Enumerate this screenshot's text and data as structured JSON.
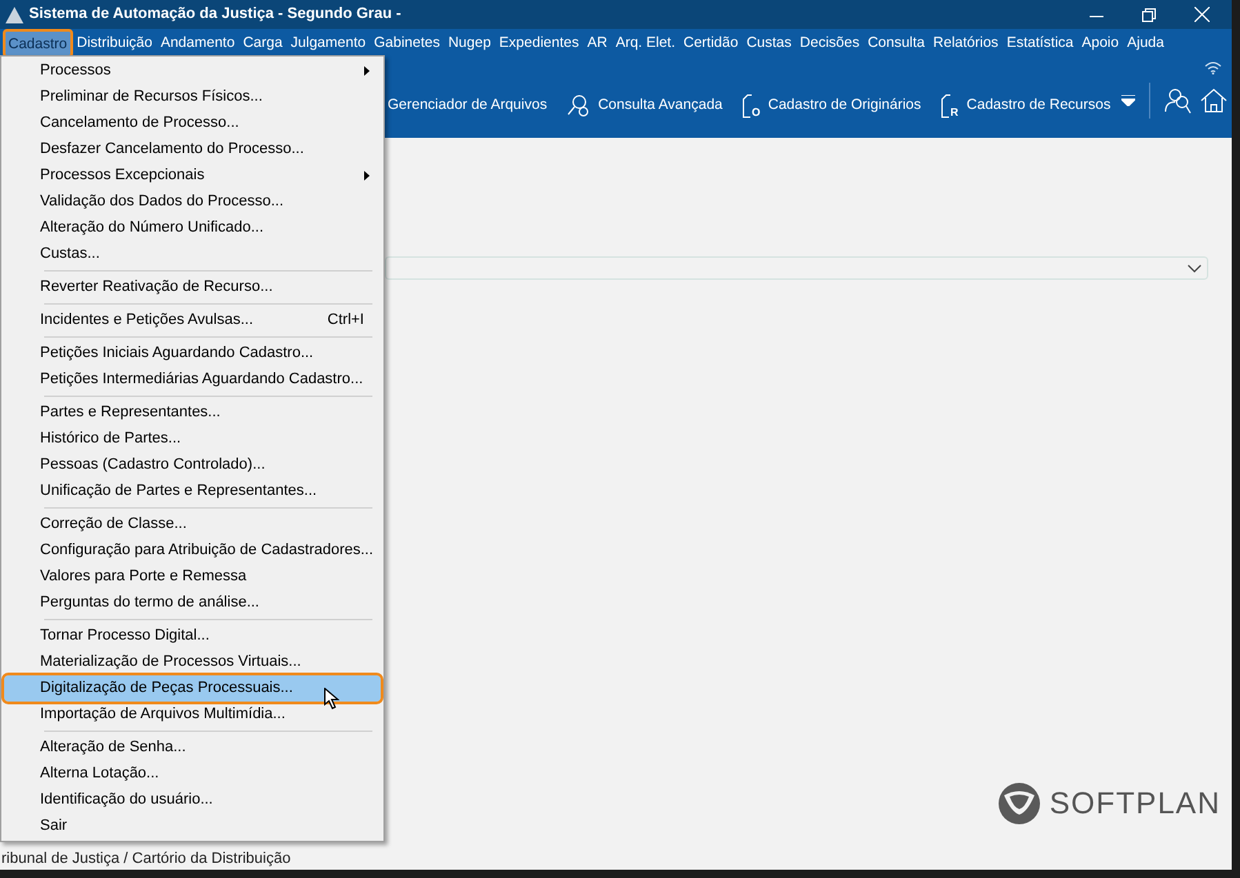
{
  "window": {
    "title": "Sistema de Automação da Justiça - Segundo Grau -"
  },
  "menu_bar": [
    {
      "label": "Cadastro",
      "selected": true
    },
    {
      "label": "Distribuição",
      "selected": false
    },
    {
      "label": "Andamento",
      "selected": false
    },
    {
      "label": "Carga",
      "selected": false
    },
    {
      "label": "Julgamento",
      "selected": false
    },
    {
      "label": "Gabinetes",
      "selected": false
    },
    {
      "label": "Nugep",
      "selected": false
    },
    {
      "label": "Expedientes",
      "selected": false
    },
    {
      "label": "AR",
      "selected": false
    },
    {
      "label": "Arq. Elet.",
      "selected": false
    },
    {
      "label": "Certidão",
      "selected": false
    },
    {
      "label": "Custas",
      "selected": false
    },
    {
      "label": "Decisões",
      "selected": false
    },
    {
      "label": "Consulta",
      "selected": false
    },
    {
      "label": "Relatórios",
      "selected": false
    },
    {
      "label": "Estatística",
      "selected": false
    },
    {
      "label": "Apoio",
      "selected": false
    },
    {
      "label": "Ajuda",
      "selected": false
    }
  ],
  "toolbar": [
    {
      "label": "Gerenciador de Arquivos",
      "kind": "plain"
    },
    {
      "label": "Consulta Avançada",
      "kind": "search"
    },
    {
      "label": "Cadastro de Originários",
      "kind": "doc",
      "icon_letter": "O"
    },
    {
      "label": "Cadastro de Recursos",
      "kind": "doc",
      "icon_letter": "R"
    }
  ],
  "dropdown_menu": {
    "groups": [
      [
        {
          "label": "Processos",
          "submenu": true,
          "selected": false
        },
        {
          "label": "Preliminar de Recursos Físicos...",
          "submenu": false,
          "selected": false
        },
        {
          "label": "Cancelamento de Processo...",
          "submenu": false,
          "selected": false
        },
        {
          "label": "Desfazer Cancelamento do Processo...",
          "submenu": false,
          "selected": false
        },
        {
          "label": "Processos Excepcionais",
          "submenu": true,
          "selected": false
        },
        {
          "label": "Validação dos Dados do Processo...",
          "submenu": false,
          "selected": false
        },
        {
          "label": "Alteração do Número Unificado...",
          "submenu": false,
          "selected": false
        },
        {
          "label": "Custas...",
          "submenu": false,
          "selected": false
        }
      ],
      [
        {
          "label": "Reverter Reativação de Recurso...",
          "submenu": false,
          "selected": false
        }
      ],
      [
        {
          "label": "Incidentes e Petições Avulsas...",
          "shortcut": "Ctrl+I",
          "submenu": false,
          "selected": false
        }
      ],
      [
        {
          "label": "Petições Iniciais Aguardando Cadastro...",
          "submenu": false,
          "selected": false
        },
        {
          "label": "Petições Intermediárias Aguardando Cadastro...",
          "submenu": false,
          "selected": false
        }
      ],
      [
        {
          "label": "Partes e Representantes...",
          "submenu": false,
          "selected": false
        },
        {
          "label": "Histórico de Partes...",
          "submenu": false,
          "selected": false
        },
        {
          "label": "Pessoas (Cadastro Controlado)...",
          "submenu": false,
          "selected": false
        },
        {
          "label": "Unificação de Partes e Representantes...",
          "submenu": false,
          "selected": false
        }
      ],
      [
        {
          "label": "Correção de Classe...",
          "submenu": false,
          "selected": false
        },
        {
          "label": "Configuração para Atribuição de Cadastradores...",
          "submenu": false,
          "selected": false
        },
        {
          "label": "Valores para Porte e Remessa",
          "submenu": false,
          "selected": false
        },
        {
          "label": "Perguntas do termo de análise...",
          "submenu": false,
          "selected": false
        }
      ],
      [
        {
          "label": "Tornar Processo Digital...",
          "submenu": false,
          "selected": false
        },
        {
          "label": "Materialização de Processos Virtuais...",
          "submenu": false,
          "selected": false
        },
        {
          "label": "Digitalização de Peças Processuais...",
          "submenu": false,
          "selected": true
        },
        {
          "label": "Importação de Arquivos Multimídia...",
          "submenu": false,
          "selected": false
        }
      ],
      [
        {
          "label": "Alteração de Senha...",
          "submenu": false,
          "selected": false
        },
        {
          "label": "Alterna Lotação...",
          "submenu": false,
          "selected": false
        },
        {
          "label": "Identificação do usuário...",
          "submenu": false,
          "selected": false
        },
        {
          "label": "Sair",
          "submenu": false,
          "selected": false
        }
      ]
    ]
  },
  "logo": {
    "text": "SOFTPLAN"
  },
  "status_bar": {
    "text": "ribunal de Justiça / Cartório da Distribuição"
  }
}
